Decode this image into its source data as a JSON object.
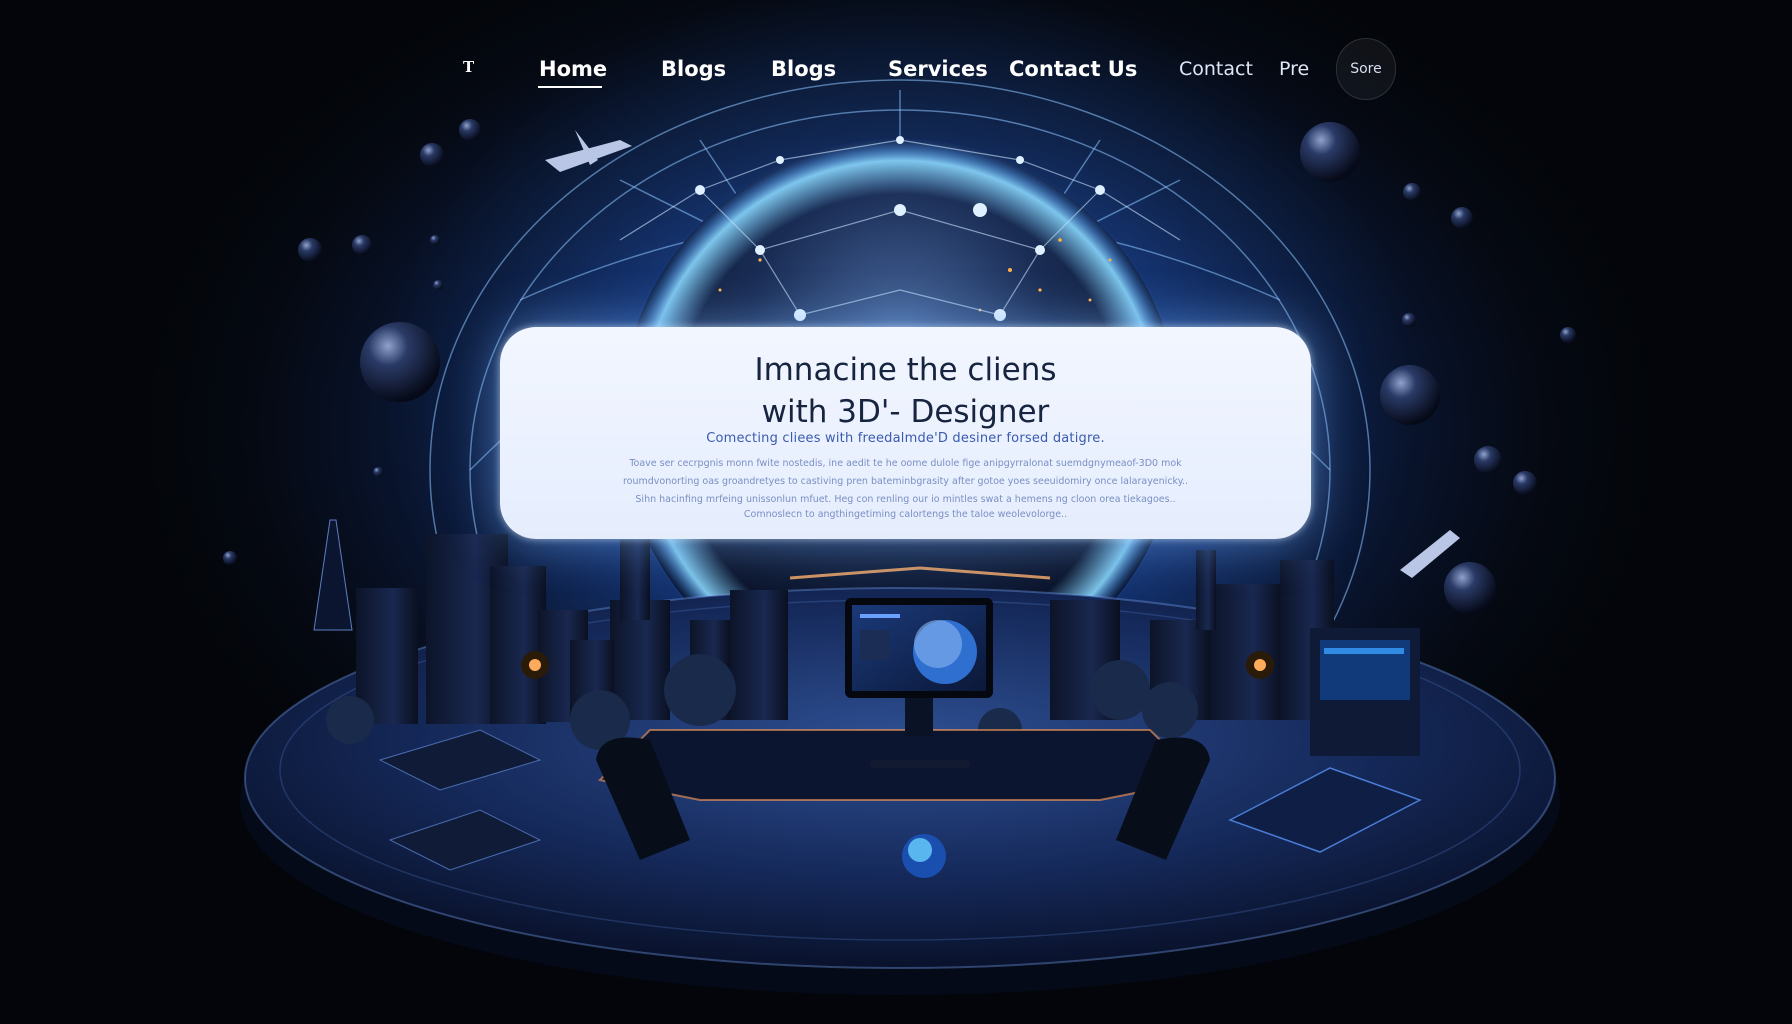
{
  "nav": {
    "logo": "T",
    "items": [
      "Home",
      "Blogs",
      "Blogs",
      "Services",
      "Contact Us"
    ],
    "secondary": [
      "Contact",
      "Pre"
    ],
    "pill": "Sore"
  },
  "hero": {
    "title_line1": "Imnacine the cliens",
    "title_line2": "with 3D'- Designer",
    "subtitle": "Comecting cliees with freedalmde'D desiner forsed datigre.",
    "body": [
      "Toave ser cecrpgnis monn fwite nostedis, ine aedit te he oome dulole fige anipgyrralonat suemdgnymeaof-3D0 mok",
      "roumdvonorting oas groandretyes to castiving pren bateminbgrasity after gotoe yoes seeuidomiry once lalarayenicky..",
      "Sihn hacinfing mrfeing unissonlun mfuet. Heg con renling our io mintles swat a hemens ng cloon orea tiekagoes.."
    ],
    "footer": "Comnoslecn to angthingetiming calortengs the taloe weolevolorge.."
  },
  "colors": {
    "background": "#050912",
    "accent_glow": "#3d8bff",
    "card": "#eef3ff",
    "title_text": "#16243f",
    "subtitle_text": "#3a5bb0"
  },
  "icons": {
    "logo": "serif-t-logo",
    "scene": "3d-designer-workspace-illustration"
  }
}
